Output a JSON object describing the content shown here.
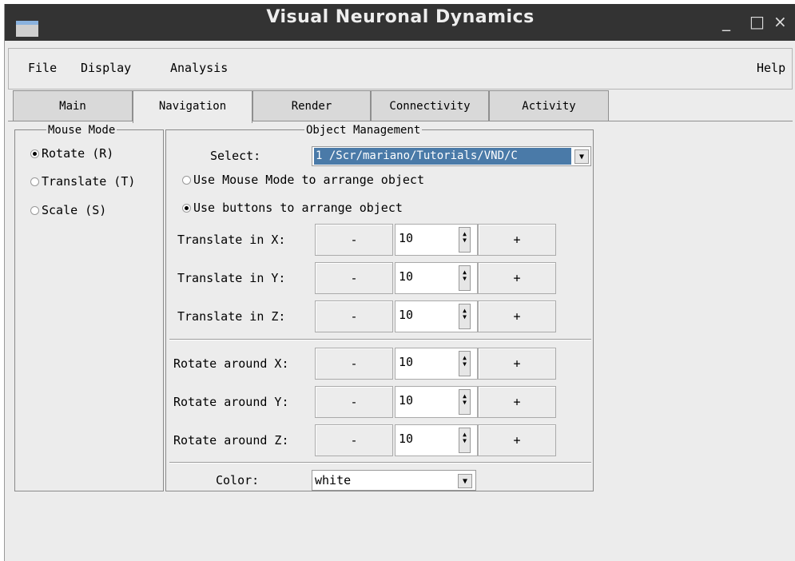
{
  "window": {
    "title": "Visual Neuronal Dynamics",
    "controls": [
      "_",
      "□",
      "×"
    ]
  },
  "menus": {
    "file": "File",
    "display": "Display",
    "analysis": "Analysis",
    "help": "Help"
  },
  "tabs": [
    "Main",
    "Navigation",
    "Render",
    "Connectivity",
    "Activity"
  ],
  "active_tab": "Navigation",
  "mouse_mode": {
    "title": "Mouse Mode",
    "options": [
      "Rotate (R)",
      "Translate (T)",
      "Scale (S)"
    ],
    "selected": "Rotate (R)"
  },
  "object_management": {
    "title": "Object Management",
    "select_label": "Select:",
    "select_value": "1 /Scr/mariano/Tutorials/VND/C",
    "arrange_options": [
      "Use Mouse Mode to arrange object",
      "Use buttons to arrange object"
    ],
    "arrange_selected": "Use buttons to arrange object",
    "rows": [
      {
        "label": "Translate in X:",
        "minus": "-",
        "value": "10",
        "plus": "+"
      },
      {
        "label": "Translate in Y:",
        "minus": "-",
        "value": "10",
        "plus": "+"
      },
      {
        "label": "Translate in Z:",
        "minus": "-",
        "value": "10",
        "plus": "+"
      },
      {
        "label": "Rotate around X:",
        "minus": "-",
        "value": "10",
        "plus": "+"
      },
      {
        "label": "Rotate around Y:",
        "minus": "-",
        "value": "10",
        "plus": "+"
      },
      {
        "label": "Rotate around Z:",
        "minus": "-",
        "value": "10",
        "plus": "+"
      }
    ],
    "color_label": "Color:",
    "color_value": "white"
  },
  "colors": {
    "titlebar": "#333333",
    "selection": "#4a7aa8",
    "panel": "#ececec"
  }
}
